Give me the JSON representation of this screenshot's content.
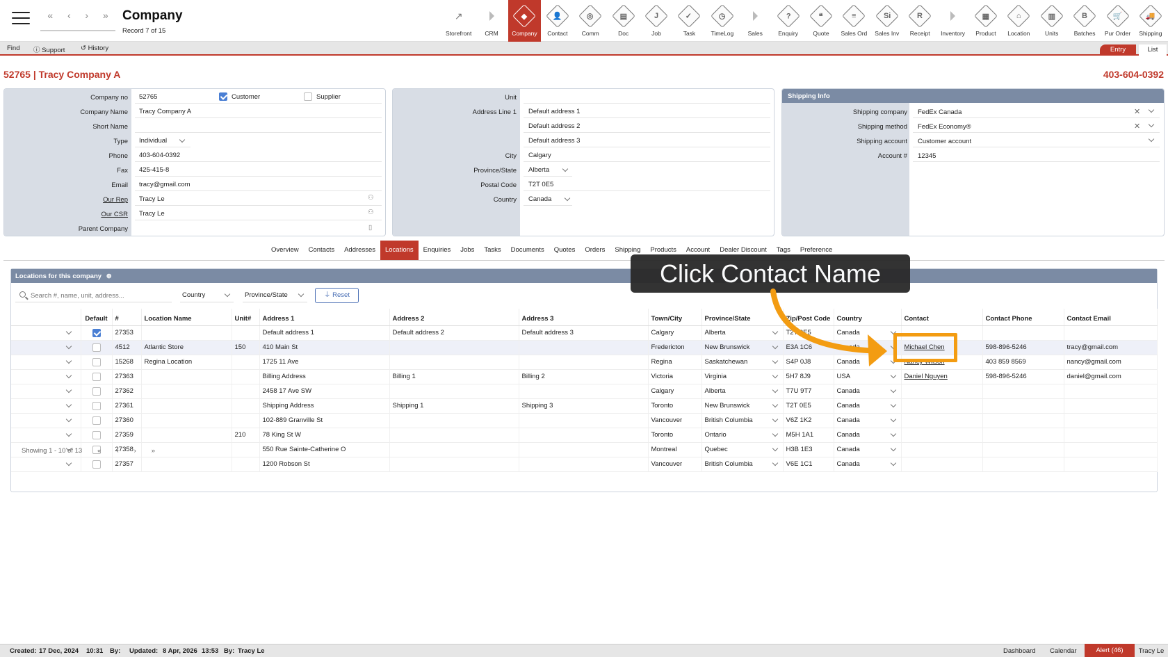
{
  "header": {
    "title": "Company",
    "record": "Record 7 of 15"
  },
  "nav_icons": [
    "first-record-icon",
    "prev-record-icon",
    "next-record-icon",
    "last-record-icon"
  ],
  "modules": [
    {
      "label": "Storefront",
      "glyph": "↗",
      "kind": "plain"
    },
    {
      "label": "CRM",
      "glyph": "",
      "kind": "sep"
    },
    {
      "label": "Company",
      "glyph": "◆",
      "kind": "active"
    },
    {
      "label": "Contact",
      "glyph": "👤",
      "kind": "d"
    },
    {
      "label": "Comm",
      "glyph": "◎",
      "kind": "d"
    },
    {
      "label": "Doc",
      "glyph": "▤",
      "kind": "d"
    },
    {
      "label": "Job",
      "glyph": "J",
      "kind": "d"
    },
    {
      "label": "Task",
      "glyph": "✓",
      "kind": "d"
    },
    {
      "label": "TimeLog",
      "glyph": "◷",
      "kind": "d"
    },
    {
      "label": "Sales",
      "glyph": "",
      "kind": "sep"
    },
    {
      "label": "Enquiry",
      "glyph": "?",
      "kind": "d"
    },
    {
      "label": "Quote",
      "glyph": "❝",
      "kind": "d"
    },
    {
      "label": "Sales Ord",
      "glyph": "≡",
      "kind": "d"
    },
    {
      "label": "Sales Inv",
      "glyph": "Si",
      "kind": "d"
    },
    {
      "label": "Receipt",
      "glyph": "R",
      "kind": "d"
    },
    {
      "label": "Inventory",
      "glyph": "",
      "kind": "sep"
    },
    {
      "label": "Product",
      "glyph": "▦",
      "kind": "d"
    },
    {
      "label": "Location",
      "glyph": "⌂",
      "kind": "d"
    },
    {
      "label": "Units",
      "glyph": "▥",
      "kind": "d"
    },
    {
      "label": "Batches",
      "glyph": "B",
      "kind": "d"
    },
    {
      "label": "Pur Order",
      "glyph": "🛒",
      "kind": "d"
    },
    {
      "label": "Shipping",
      "glyph": "🚚",
      "kind": "d"
    }
  ],
  "toolbar": {
    "find": "Find",
    "support": "Support",
    "history": "History",
    "entry": "Entry",
    "list": "List"
  },
  "company": {
    "id_title": "52765 | Tracy Company A",
    "phone_title": "403-604-0392",
    "labels": {
      "company_no": "Company no",
      "company_name": "Company Name",
      "short_name": "Short Name",
      "type": "Type",
      "phone": "Phone",
      "fax": "Fax",
      "email": "Email",
      "our_rep": "Our Rep",
      "our_csr": "Our CSR",
      "parent": "Parent Company",
      "customer": "Customer",
      "supplier": "Supplier"
    },
    "company_no": "52765",
    "company_name": "Tracy Company A",
    "short_name": "",
    "type": "Individual",
    "phone": "403-604-0392",
    "fax": "425-415-8",
    "email": "tracy@gmail.com",
    "our_rep": "Tracy Le",
    "our_csr": "Tracy Le",
    "parent": "",
    "customer": true,
    "supplier": false
  },
  "address": {
    "labels": {
      "unit": "Unit",
      "line1": "Address Line 1",
      "city": "City",
      "province": "Province/State",
      "postal": "Postal Code",
      "country": "Country"
    },
    "unit": "",
    "line1": "Default address 1",
    "line2": "Default address 2",
    "line3": "Default address 3",
    "city": "Calgary",
    "province": "Alberta",
    "postal": "T2T 0E5",
    "country": "Canada"
  },
  "shipping": {
    "title": "Shipping Info",
    "labels": {
      "company": "Shipping company",
      "method": "Shipping method",
      "account": "Shipping account",
      "account_no": "Account #"
    },
    "company": "FedEx Canada",
    "method": "FedEx Economy®",
    "account": "Customer account",
    "account_no": "12345"
  },
  "tabs": [
    "Overview",
    "Contacts",
    "Addresses",
    "Locations",
    "Enquiries",
    "Jobs",
    "Tasks",
    "Documents",
    "Quotes",
    "Orders",
    "Shipping",
    "Products",
    "Account",
    "Dealer Discount",
    "Tags",
    "Preference"
  ],
  "active_tab": "Locations",
  "locations": {
    "title": "Locations for this company",
    "search_placeholder": "Search #, name, unit, address...",
    "filter_country": "Country",
    "filter_province": "Province/State",
    "reset": "Reset",
    "columns": [
      "",
      "Default",
      "#",
      "Location Name",
      "Unit#",
      "Address 1",
      "Address 2",
      "Address 3",
      "Town/City",
      "Province/State",
      "Zip/Post Code",
      "Country",
      "Contact",
      "Contact Phone",
      "Contact Email"
    ],
    "rows": [
      {
        "def": true,
        "num": "27353",
        "name": "",
        "unit": "",
        "a1": "Default address 1",
        "a2": "Default address 2",
        "a3": "Default address 3",
        "city": "Calgary",
        "prov": "Alberta",
        "zip": "T2T 0E5",
        "country": "Canada",
        "contact": "",
        "cphone": "",
        "cemail": ""
      },
      {
        "def": false,
        "num": "4512",
        "name": "Atlantic Store",
        "unit": "150",
        "a1": "410 Main St",
        "a2": "",
        "a3": "",
        "city": "Fredericton",
        "prov": "New Brunswick",
        "zip": "E3A 1C6",
        "country": "Canada",
        "contact": "Michael Chen",
        "cphone": "598-896-5246",
        "cemail": "tracy@gmail.com",
        "hl": true
      },
      {
        "def": false,
        "num": "15268",
        "name": "Regina Location",
        "unit": "",
        "a1": "1725 11 Ave",
        "a2": "",
        "a3": "",
        "city": "Regina",
        "prov": "Saskatchewan",
        "zip": "S4P 0J8",
        "country": "Canada",
        "contact": "Nancy Wilson",
        "cphone": "403 859 8569",
        "cemail": "nancy@gmail.com"
      },
      {
        "def": false,
        "num": "27363",
        "name": "",
        "unit": "",
        "a1": "Billing Address",
        "a2": "Billing 1",
        "a3": "Billing 2",
        "city": "Victoria",
        "prov": "Virginia",
        "zip": "5H7 8J9",
        "country": "USA",
        "contact": "Daniel Nguyen",
        "cphone": "598-896-5246",
        "cemail": "daniel@gmail.com"
      },
      {
        "def": false,
        "num": "27362",
        "name": "",
        "unit": "",
        "a1": "2458 17 Ave SW",
        "a2": "",
        "a3": "",
        "city": "Calgary",
        "prov": "Alberta",
        "zip": "T7U 9T7",
        "country": "Canada",
        "contact": "",
        "cphone": "",
        "cemail": ""
      },
      {
        "def": false,
        "num": "27361",
        "name": "",
        "unit": "",
        "a1": "Shipping Address",
        "a2": "Shipping 1",
        "a3": "Shipping 3",
        "city": "Toronto",
        "prov": "New Brunswick",
        "zip": "T2T 0E5",
        "country": "Canada",
        "contact": "",
        "cphone": "",
        "cemail": ""
      },
      {
        "def": false,
        "num": "27360",
        "name": "",
        "unit": "",
        "a1": "102-889 Granville St",
        "a2": "",
        "a3": "",
        "city": "Vancouver",
        "prov": "British Columbia",
        "zip": "V6Z 1K2",
        "country": "Canada",
        "contact": "",
        "cphone": "",
        "cemail": ""
      },
      {
        "def": false,
        "num": "27359",
        "name": "",
        "unit": "210",
        "a1": "78 King St W",
        "a2": "",
        "a3": "",
        "city": "Toronto",
        "prov": "Ontario",
        "zip": "M5H 1A1",
        "country": "Canada",
        "contact": "",
        "cphone": "",
        "cemail": ""
      },
      {
        "def": false,
        "num": "27358",
        "name": "",
        "unit": "",
        "a1": "550 Rue Sainte-Catherine O",
        "a2": "",
        "a3": "",
        "city": "Montreal",
        "prov": "Quebec",
        "zip": "H3B 1E3",
        "country": "Canada",
        "contact": "",
        "cphone": "",
        "cemail": ""
      },
      {
        "def": false,
        "num": "27357",
        "name": "",
        "unit": "",
        "a1": "1200 Robson St",
        "a2": "",
        "a3": "",
        "city": "Vancouver",
        "prov": "British Columbia",
        "zip": "V6E 1C1",
        "country": "Canada",
        "contact": "",
        "cphone": "",
        "cemail": ""
      }
    ],
    "showing": "Showing 1 - 10 of 13"
  },
  "callout": "Click Contact Name",
  "accent": "#c0392b",
  "highlight": "#f39c12",
  "footer": {
    "created_label": "Created:",
    "created": "17 Dec, 2024",
    "created_time": "10:31",
    "by_label": "By:",
    "updated_label": "Updated:",
    "updated": "8 Apr, 2026",
    "updated_time": "13:53",
    "by_label2": "By:",
    "updated_by": "Tracy Le",
    "dashboard": "Dashboard",
    "calendar": "Calendar",
    "alert": "Alert (46)",
    "user": "Tracy Le"
  }
}
